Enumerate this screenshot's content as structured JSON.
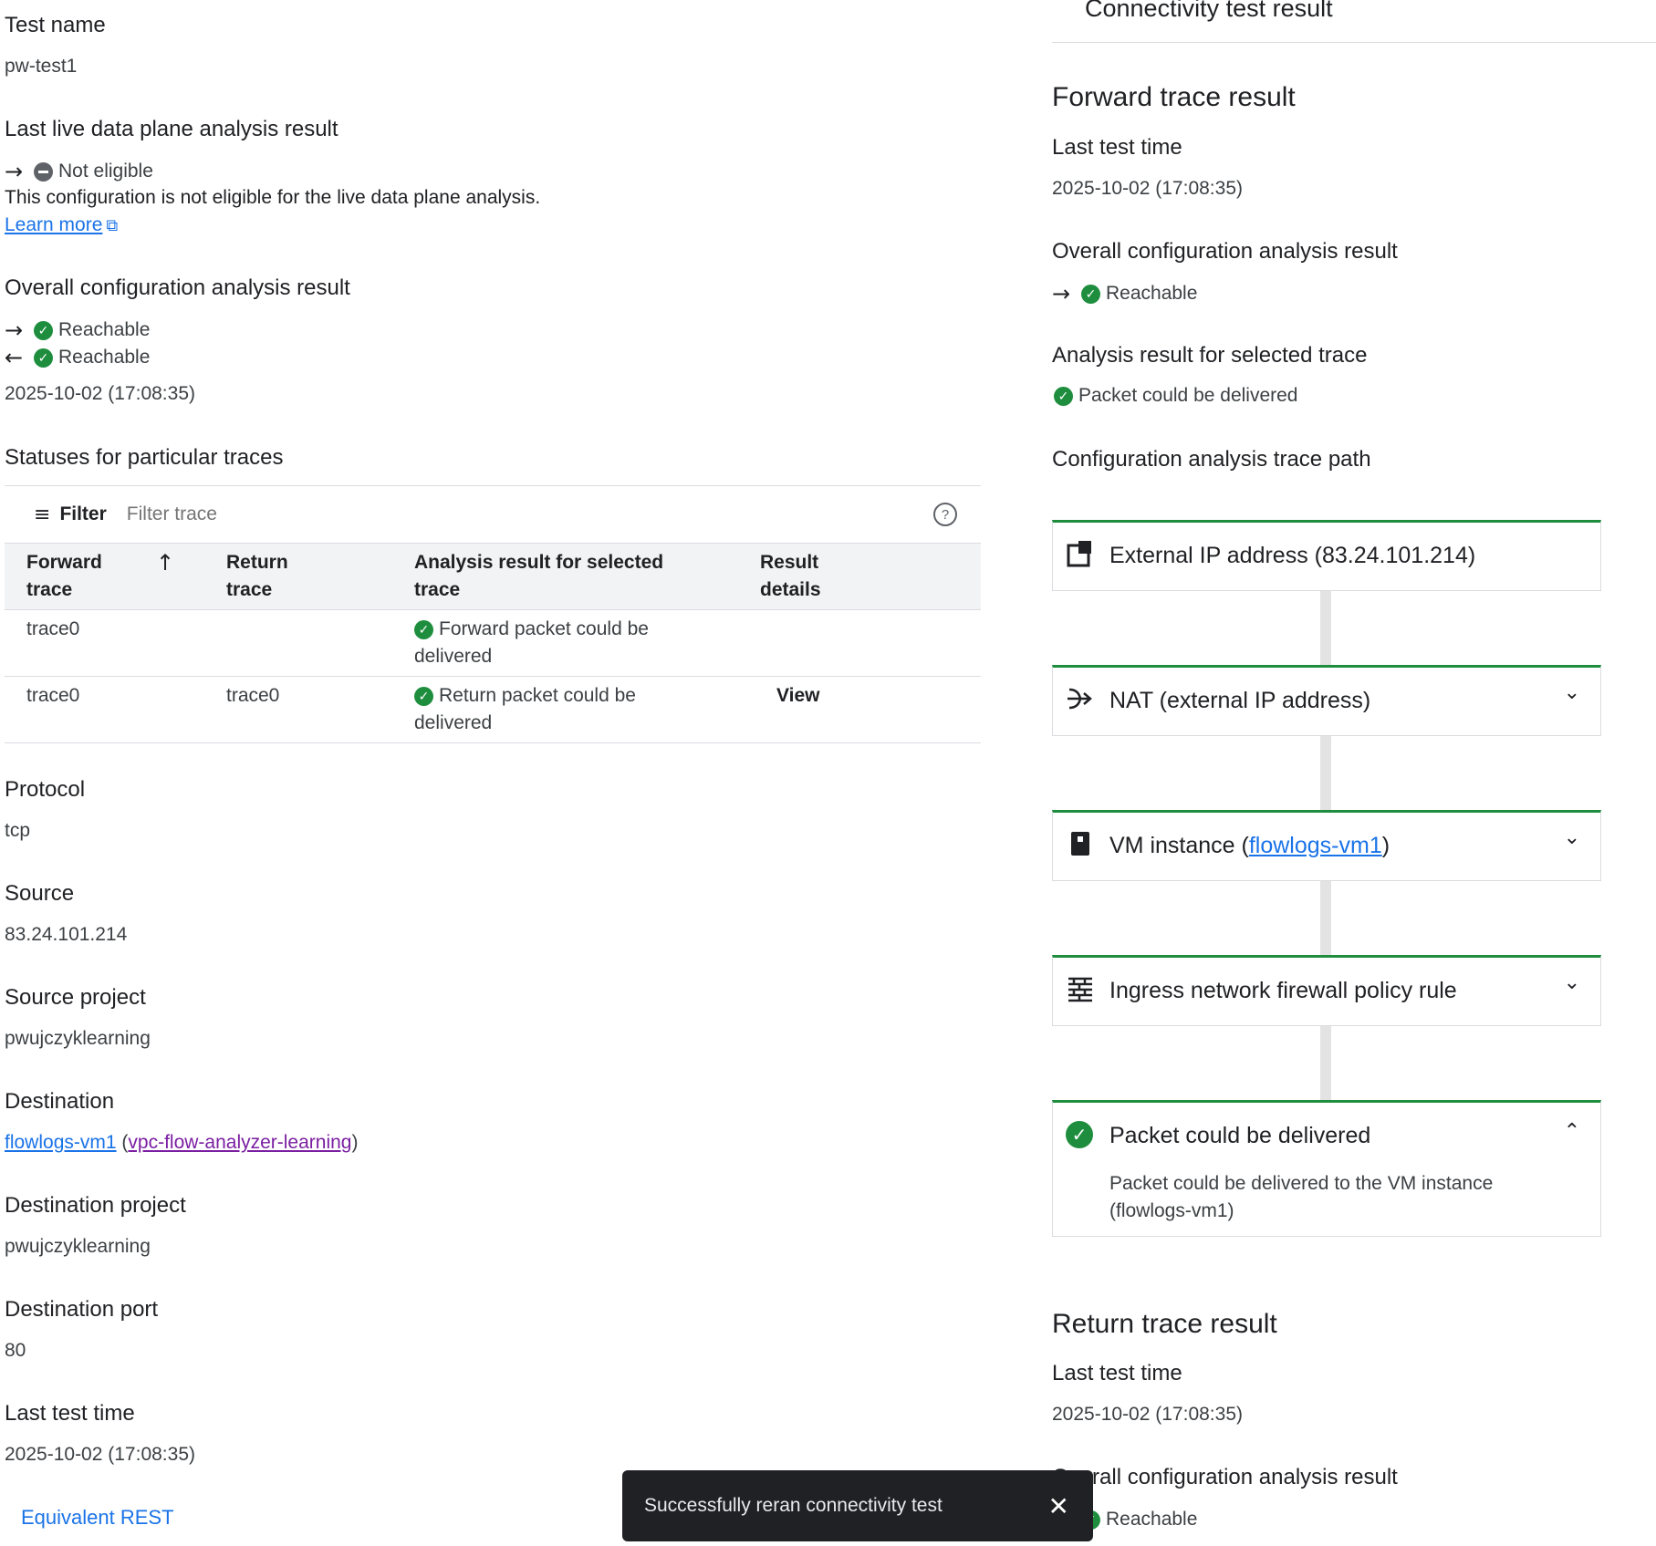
{
  "left": {
    "test_name": {
      "label": "Test name",
      "value": "pw-test1"
    },
    "live": {
      "label": "Last live data plane analysis result",
      "status": "Not eligible",
      "message": "This configuration is not eligible for the live data plane analysis.",
      "link": "Learn more"
    },
    "overall": {
      "label": "Overall configuration analysis result",
      "forward": "Reachable",
      "return": "Reachable",
      "time": "2025-10-02 (17:08:35)"
    },
    "statuses": {
      "label": "Statuses for particular traces",
      "filter_label": "Filter",
      "filter_placeholder": "Filter trace",
      "headers": {
        "forward_1": "Forward",
        "forward_2": "trace",
        "return_1": "Return",
        "return_2": "trace",
        "analysis_1": "Analysis result for selected",
        "analysis_2": "trace",
        "details_1": "Result",
        "details_2": "details"
      },
      "rows": [
        {
          "forward": "trace0",
          "return": "",
          "result_1": "Forward packet could be",
          "result_2": "delivered",
          "details": ""
        },
        {
          "forward": "trace0",
          "return": "trace0",
          "result_1": "Return packet could be",
          "result_2": "delivered",
          "details": "View"
        }
      ]
    },
    "protocol": {
      "label": "Protocol",
      "value": "tcp"
    },
    "source": {
      "label": "Source",
      "value": "83.24.101.214"
    },
    "source_project": {
      "label": "Source project",
      "value": "pwujczyklearning"
    },
    "destination": {
      "label": "Destination",
      "link1": "flowlogs-vm1",
      "open": "(",
      "link2": "vpc-flow-analyzer-learning",
      "close": ")"
    },
    "destination_project": {
      "label": "Destination project",
      "value": "pwujczyklearning"
    },
    "destination_port": {
      "label": "Destination port",
      "value": "80"
    },
    "last_test_time": {
      "label": "Last test time",
      "value": "2025-10-02 (17:08:35)"
    },
    "equivalent_rest": "Equivalent REST"
  },
  "right": {
    "panel_title": "Connectivity test result",
    "forward": {
      "title": "Forward trace result",
      "last_test_label": "Last test time",
      "last_test_value": "2025-10-02 (17:08:35)",
      "overall_label": "Overall configuration analysis result",
      "overall_value": "Reachable",
      "selected_label": "Analysis result for selected trace",
      "selected_value": "Packet could be delivered",
      "path_label": "Configuration analysis trace path"
    },
    "path": {
      "step1": "External IP address (83.24.101.214)",
      "step2": "NAT (external IP address)",
      "step3_prefix": "VM instance (",
      "step3_link": "flowlogs-vm1",
      "step3_suffix": ")",
      "step4": "Ingress network firewall policy rule",
      "step5": "Packet could be delivered",
      "step5_desc_1": "Packet could be delivered to the VM instance",
      "step5_desc_2": "(flowlogs-vm1)"
    },
    "return": {
      "title": "Return trace result",
      "last_test_label": "Last test time",
      "last_test_value": "2025-10-02 (17:08:35)",
      "overall_label": "Overall configuration analysis result",
      "overall_value": "Reachable"
    }
  },
  "snackbar": {
    "message": "Successfully reran connectivity test"
  },
  "colors": {
    "success": "#1e8e3e",
    "link": "#1a73e8",
    "visited": "#7b1fa2",
    "snackbar": "#202124"
  }
}
